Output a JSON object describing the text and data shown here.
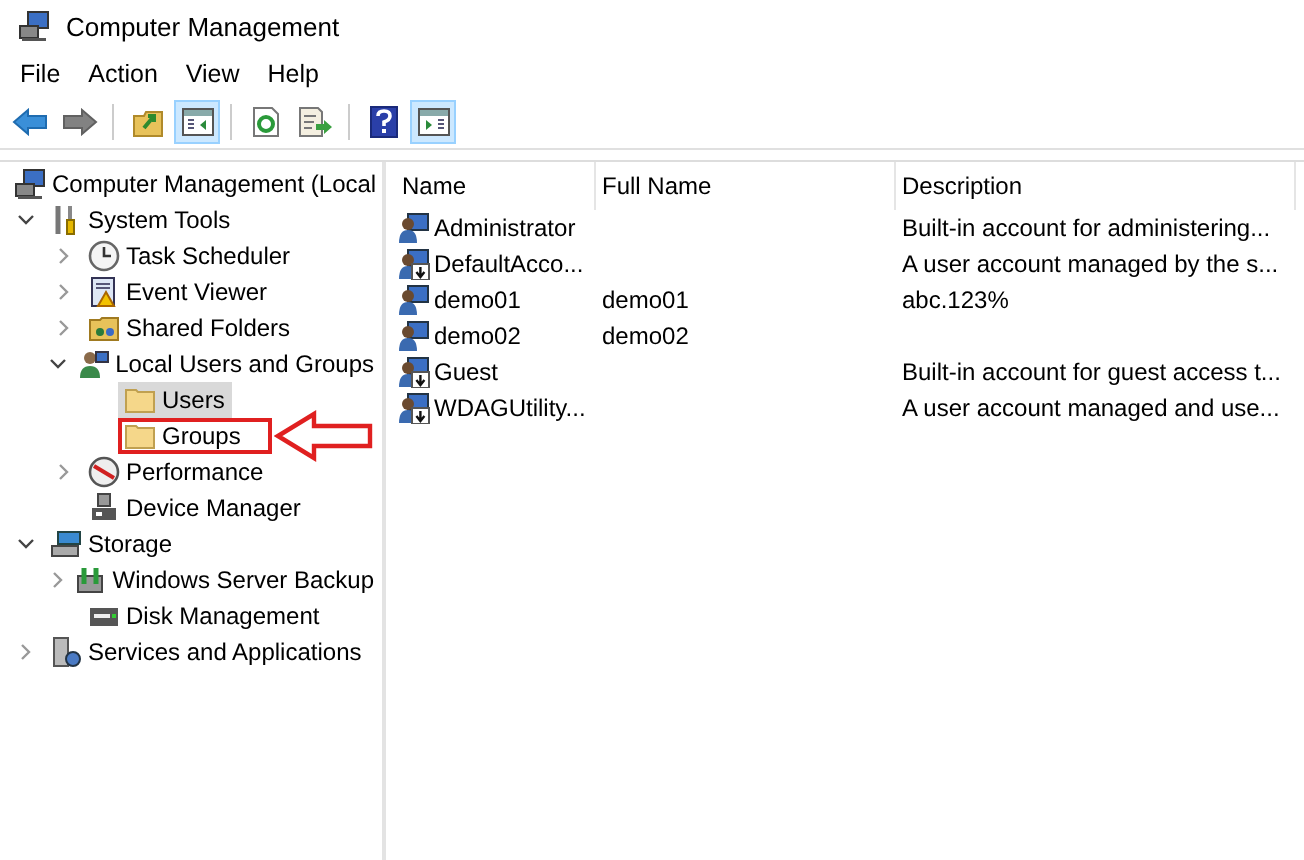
{
  "window": {
    "title": "Computer Management"
  },
  "menu": [
    "File",
    "Action",
    "View",
    "Help"
  ],
  "toolbar": [
    {
      "kind": "back",
      "pressed": false,
      "disabled": false
    },
    {
      "kind": "forward",
      "pressed": false,
      "disabled": true
    },
    {
      "kind": "separator"
    },
    {
      "kind": "up",
      "pressed": false,
      "disabled": false
    },
    {
      "kind": "tree-pane",
      "pressed": true,
      "disabled": false
    },
    {
      "kind": "separator"
    },
    {
      "kind": "refresh",
      "pressed": false,
      "disabled": false
    },
    {
      "kind": "export",
      "pressed": false,
      "disabled": false
    },
    {
      "kind": "separator"
    },
    {
      "kind": "help",
      "pressed": false,
      "disabled": false
    },
    {
      "kind": "action-pane",
      "pressed": true,
      "disabled": false
    }
  ],
  "tree": [
    {
      "label": "Computer Management (Local",
      "kind": "computer",
      "selected": false,
      "callout": false,
      "children": [
        {
          "label": "System Tools",
          "kind": "tools",
          "expanded": true,
          "selected": false,
          "callout": false,
          "children": [
            {
              "label": "Task Scheduler",
              "kind": "clock",
              "expanded": false,
              "selected": false,
              "callout": false
            },
            {
              "label": "Event Viewer",
              "kind": "log",
              "expanded": false,
              "selected": false,
              "callout": false
            },
            {
              "label": "Shared Folders",
              "kind": "share",
              "expanded": false,
              "selected": false,
              "callout": false
            },
            {
              "label": "Local Users and Groups",
              "kind": "users",
              "expanded": true,
              "selected": false,
              "callout": false,
              "children": [
                {
                  "label": "Users",
                  "kind": "folder",
                  "selected": true,
                  "callout": false
                },
                {
                  "label": "Groups",
                  "kind": "folder",
                  "selected": false,
                  "callout": true
                }
              ]
            },
            {
              "label": "Performance",
              "kind": "gauge",
              "expanded": false,
              "selected": false,
              "callout": false
            },
            {
              "label": "Device Manager",
              "kind": "device",
              "selected": false,
              "callout": false
            }
          ]
        },
        {
          "label": "Storage",
          "kind": "storage",
          "expanded": true,
          "selected": false,
          "callout": false,
          "children": [
            {
              "label": "Windows Server Backup",
              "kind": "backup",
              "expanded": false,
              "selected": false,
              "callout": false
            },
            {
              "label": "Disk Management",
              "kind": "disk",
              "selected": false,
              "callout": false
            }
          ]
        },
        {
          "label": "Services and Applications",
          "kind": "services",
          "expanded": false,
          "selected": false,
          "callout": false
        }
      ]
    }
  ],
  "table": {
    "columns": [
      "Name",
      "Full Name",
      "Description"
    ],
    "rows": [
      {
        "name": "Administrator",
        "full_name": "",
        "description": "Built-in account for administering...",
        "disabled": false
      },
      {
        "name": "DefaultAcco...",
        "full_name": "",
        "description": "A user account managed by the s...",
        "disabled": true
      },
      {
        "name": "demo01",
        "full_name": "demo01",
        "description": "abc.123%",
        "disabled": false
      },
      {
        "name": "demo02",
        "full_name": "demo02",
        "description": "",
        "disabled": false
      },
      {
        "name": "Guest",
        "full_name": "",
        "description": "Built-in account for guest access t...",
        "disabled": true
      },
      {
        "name": "WDAGUtility...",
        "full_name": "",
        "description": "A user account managed and use...",
        "disabled": true
      }
    ]
  }
}
